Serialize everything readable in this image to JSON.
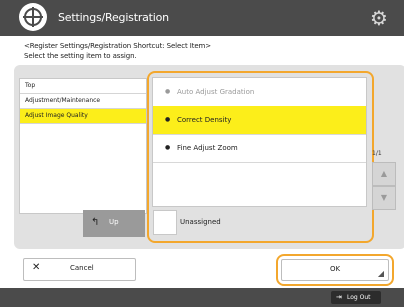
{
  "header": {
    "title": "Settings/Registration"
  },
  "instructions": {
    "line1": "<Register Settings/Registration Shortcut: Select Item>",
    "line2": "Select the setting item to assign."
  },
  "left_list": {
    "items": [
      "Top",
      "Adjustment/Maintenance",
      "Adjust Image Quality"
    ],
    "selected_index": 2,
    "up_label": "Up"
  },
  "right_list": {
    "options": [
      {
        "label": "Auto Adjust Gradation",
        "state": "disabled"
      },
      {
        "label": "Correct Density",
        "state": "selected"
      },
      {
        "label": "Fine Adjust Zoom",
        "state": "normal"
      }
    ],
    "unassigned_label": "Unassigned"
  },
  "pager": {
    "text": "1/1",
    "up_symbol": "▲",
    "down_symbol": "▼"
  },
  "buttons": {
    "cancel": "Cancel",
    "ok": "OK"
  },
  "footer": {
    "logout": "Log Out"
  },
  "colors": {
    "header_bg": "#4b4b4b",
    "highlight": "#fcee1a",
    "focus_outline": "#f3a72d"
  }
}
